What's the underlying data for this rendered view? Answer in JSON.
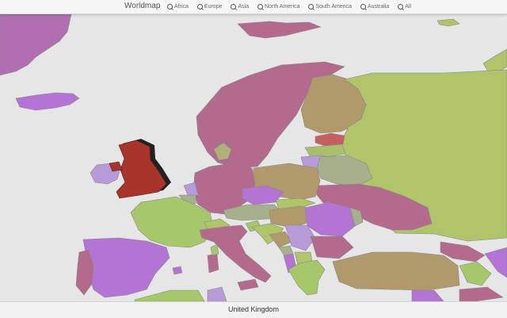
{
  "header": {
    "brand": "Worldmap",
    "nav": [
      {
        "label": "Africa",
        "icon": "search-icon"
      },
      {
        "label": "Europe",
        "icon": "search-icon"
      },
      {
        "label": "Asia",
        "icon": "search-icon"
      },
      {
        "label": "North America",
        "icon": "search-icon"
      },
      {
        "label": "South America",
        "icon": "search-icon"
      },
      {
        "label": "Australia",
        "icon": "search-icon"
      },
      {
        "label": "All",
        "icon": "search-icon"
      }
    ]
  },
  "map": {
    "ocean_color": "#e6e6e6",
    "selected_country": "United Kingdom",
    "selected_color": "#a8352c"
  },
  "footer": {
    "selected_label": "United Kingdom"
  }
}
